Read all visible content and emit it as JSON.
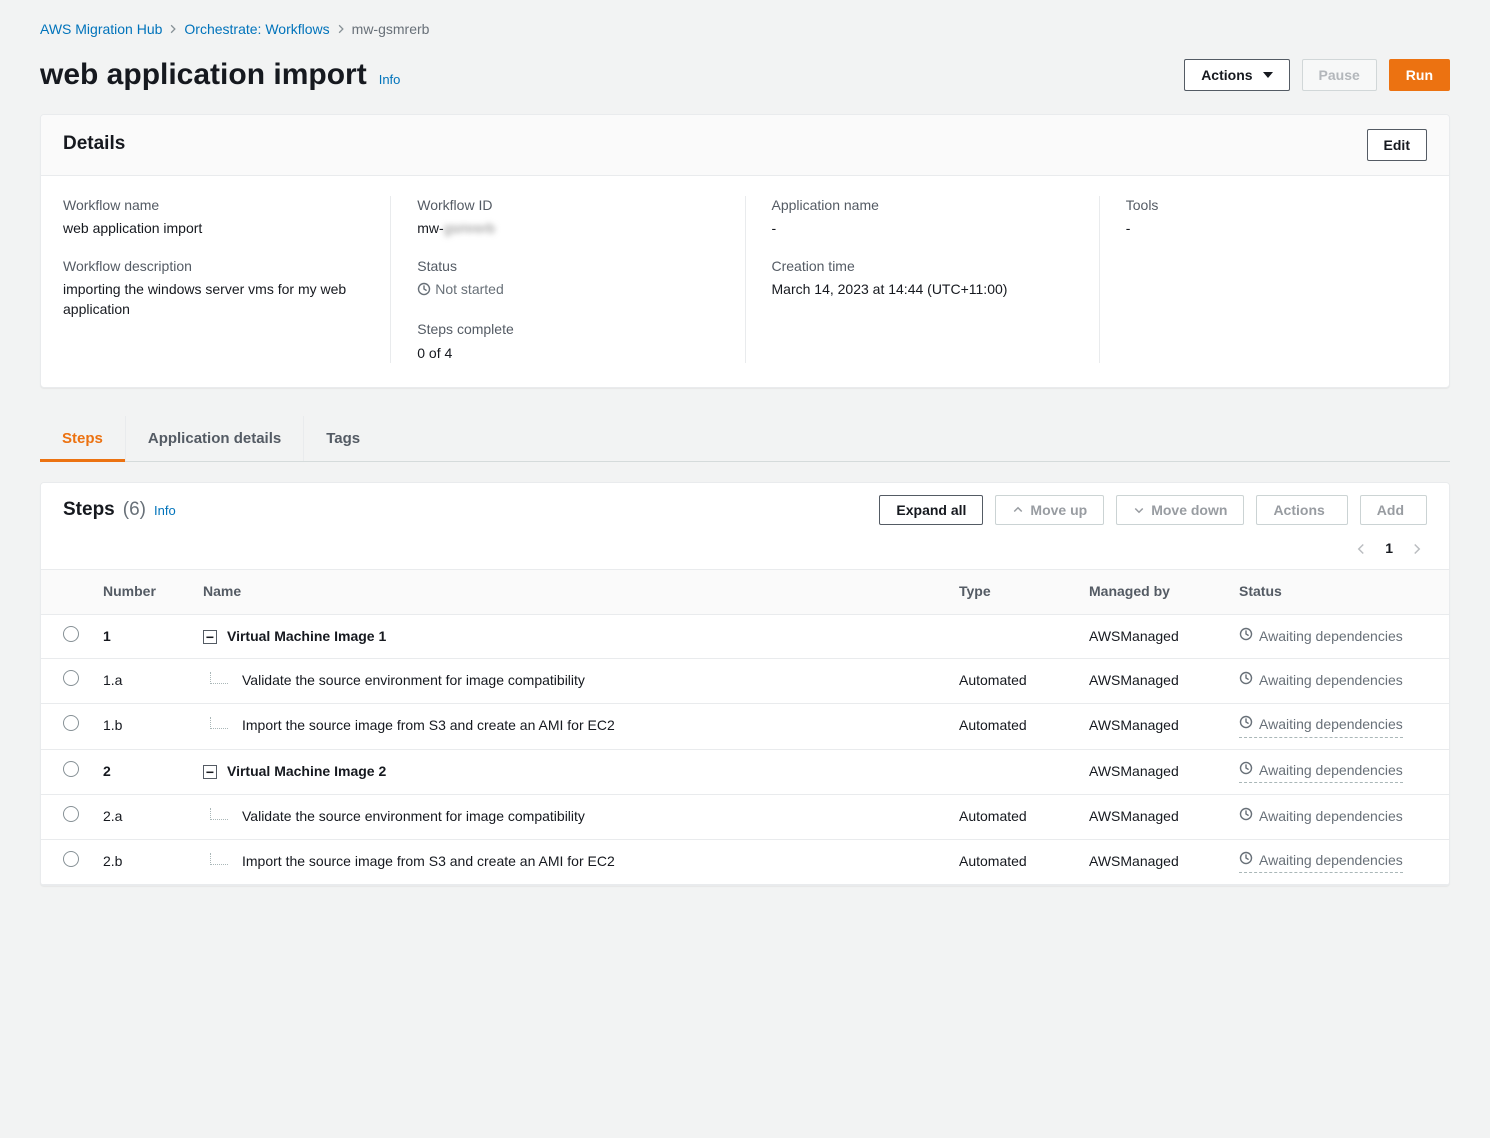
{
  "breadcrumb": {
    "items": [
      {
        "label": "AWS Migration Hub"
      },
      {
        "label": "Orchestrate: Workflows"
      }
    ],
    "current": "mw-gsmrerb"
  },
  "header": {
    "title": "web application import",
    "info": "Info",
    "actions_button": "Actions",
    "pause_button": "Pause",
    "run_button": "Run"
  },
  "details": {
    "card_title": "Details",
    "edit_button": "Edit",
    "fields": {
      "workflow_name_label": "Workflow name",
      "workflow_name_value": "web application import",
      "workflow_desc_label": "Workflow description",
      "workflow_desc_value": "importing the windows server vms for my web application",
      "workflow_id_label": "Workflow ID",
      "workflow_id_prefix": "mw-",
      "workflow_id_blurred": "gsmrerb",
      "status_label": "Status",
      "status_value": "Not started",
      "steps_complete_label": "Steps complete",
      "steps_complete_value": "0 of 4",
      "app_name_label": "Application name",
      "app_name_value": "-",
      "creation_time_label": "Creation time",
      "creation_time_value": "March 14, 2023 at 14:44 (UTC+11:00)",
      "tools_label": "Tools",
      "tools_value": "-"
    }
  },
  "tabs": [
    {
      "label": "Steps",
      "active": true
    },
    {
      "label": "Application details",
      "active": false
    },
    {
      "label": "Tags",
      "active": false
    }
  ],
  "steps": {
    "title": "Steps",
    "count": "(6)",
    "info": "Info",
    "buttons": {
      "expand_all": "Expand all",
      "move_up": "Move up",
      "move_down": "Move down",
      "actions": "Actions",
      "add": "Add"
    },
    "page": "1",
    "columns": {
      "number": "Number",
      "name": "Name",
      "type": "Type",
      "managed_by": "Managed by",
      "status": "Status"
    },
    "rows": [
      {
        "num": "1",
        "bold": true,
        "group": true,
        "name": "Virtual Machine Image 1",
        "type": "",
        "mgd": "AWSManaged",
        "status": "Awaiting dependencies",
        "dotted": false
      },
      {
        "num": "1.a",
        "bold": false,
        "group": false,
        "name": "Validate the source environment for image compatibility",
        "type": "Automated",
        "mgd": "AWSManaged",
        "status": "Awaiting dependencies",
        "dotted": false
      },
      {
        "num": "1.b",
        "bold": false,
        "group": false,
        "name": "Import the source image from S3 and create an AMI for EC2",
        "type": "Automated",
        "mgd": "AWSManaged",
        "status": "Awaiting dependencies",
        "dotted": true
      },
      {
        "num": "2",
        "bold": true,
        "group": true,
        "name": "Virtual Machine Image 2",
        "type": "",
        "mgd": "AWSManaged",
        "status": "Awaiting dependencies",
        "dotted": true
      },
      {
        "num": "2.a",
        "bold": false,
        "group": false,
        "name": "Validate the source environment for image compatibility",
        "type": "Automated",
        "mgd": "AWSManaged",
        "status": "Awaiting dependencies",
        "dotted": false
      },
      {
        "num": "2.b",
        "bold": false,
        "group": false,
        "name": "Import the source image from S3 and create an AMI for EC2",
        "type": "Automated",
        "mgd": "AWSManaged",
        "status": "Awaiting dependencies",
        "dotted": true
      }
    ]
  }
}
